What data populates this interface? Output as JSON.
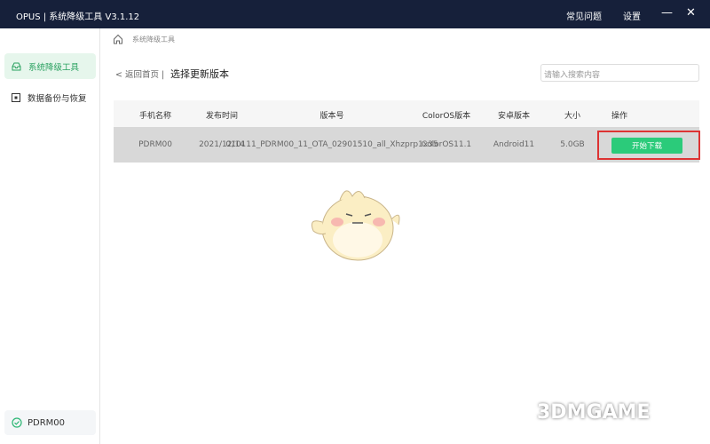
{
  "titlebar": {
    "title": "OPUS | 系统降级工具  V3.1.12",
    "faq": "常见问题",
    "settings": "设置",
    "minimize": "—",
    "close": "✕"
  },
  "sidebar": {
    "items": [
      {
        "label": "系统降级工具",
        "icon": "inbox-icon",
        "active": true
      },
      {
        "label": "数据备份与恢复",
        "icon": "square-dot-icon"
      }
    ],
    "device": "PDRM00"
  },
  "breadcrumb": {
    "label": "系统降级工具"
  },
  "header": {
    "back": "< 返回首页 |",
    "title": "选择更新版本",
    "search_placeholder": "请输入搜索内容"
  },
  "table": {
    "columns": [
      "手机名称",
      "发布时间",
      "版本号",
      "ColorOS版本",
      "安卓版本",
      "大小",
      "操作"
    ],
    "rows": [
      {
        "cells": [
          "PDRM00",
          "2021/12/14",
          "010111_PDRM00_11_OTA_02901510_all_Xhzprp1x35",
          "ColorOS11.1",
          "Android11",
          "5.0GB"
        ],
        "action": "开始下载"
      }
    ]
  },
  "watermark": "3DMGAME",
  "colors": {
    "titlebar": "#16203a",
    "accent": "#2bcb7a",
    "highlight": "#d33333"
  }
}
